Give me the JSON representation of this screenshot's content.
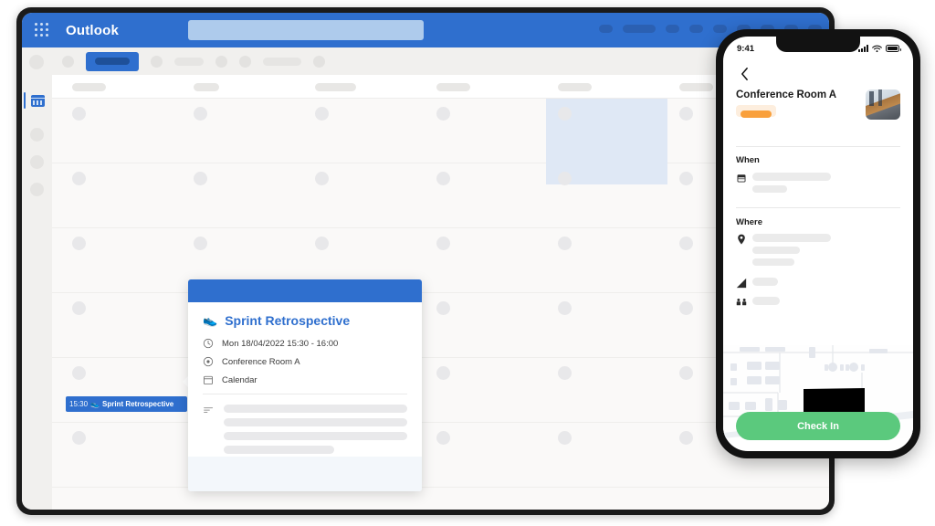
{
  "desktop": {
    "app_title": "Outlook",
    "waffle_icon": "app-launcher-waffle-icon",
    "search_placeholder": "",
    "header_pill_count": 9,
    "toolbar": {
      "active_button_label": "",
      "item_count": 8
    },
    "sidebar": {
      "active_icon": "calendar-icon",
      "item_count": 5
    },
    "calendar": {
      "column_count": 5,
      "row_count": 6,
      "selected_slot": "highlighted-time-slot",
      "event_chip": {
        "time": "15:30",
        "icon": "running-shoe-icon",
        "title": "Sprint Retrospective"
      }
    }
  },
  "popup": {
    "icon": "running-shoe-icon",
    "title": "Sprint Retrospective",
    "rows": [
      {
        "icon": "clock-icon",
        "text": "Mon 18/04/2022 15:30 - 16:00"
      },
      {
        "icon": "location-icon",
        "text": "Conference Room A"
      },
      {
        "icon": "calendar-icon",
        "text": "Calendar"
      }
    ],
    "notes_icon": "notes-icon",
    "notes_line_widths": [
      "100%",
      "100%",
      "100%",
      "60%"
    ]
  },
  "phone": {
    "status": {
      "time": "9:41",
      "signal_icon": "cellular-signal-icon",
      "wifi_icon": "wifi-icon",
      "battery_icon": "battery-full-icon"
    },
    "back_icon": "chevron-left-icon",
    "room_name": "Conference Room A",
    "room_badge": "availability-badge",
    "room_thumbnail": "conference-room-photo",
    "sections": [
      {
        "label": "When",
        "icon": "calendar-icon",
        "line_widths": [
          "86%",
          "38%"
        ]
      },
      {
        "label": "Where",
        "icon": "location-pin-icon",
        "line_widths": [
          "86%",
          "52%",
          "46%"
        ]
      }
    ],
    "extra_rows": [
      {
        "icon": "signal-strength-icon",
        "width": "28%"
      },
      {
        "icon": "seats-capacity-icon",
        "width": "30%"
      }
    ],
    "map": {
      "label": "floor-plan-map",
      "highlight_color": "#ec1278"
    },
    "check_in_label": "Check In"
  },
  "colors": {
    "outlook_blue": "#2f6fce",
    "outlook_blue_dark": "#1e5099",
    "search_blue": "#aecbec",
    "selected_slot": "#dfe8f5",
    "check_in_green": "#5bc97d",
    "map_highlight": "#ec1278",
    "badge_orange": "#f9a03c",
    "skeleton_gray": "#e9e9eb"
  }
}
